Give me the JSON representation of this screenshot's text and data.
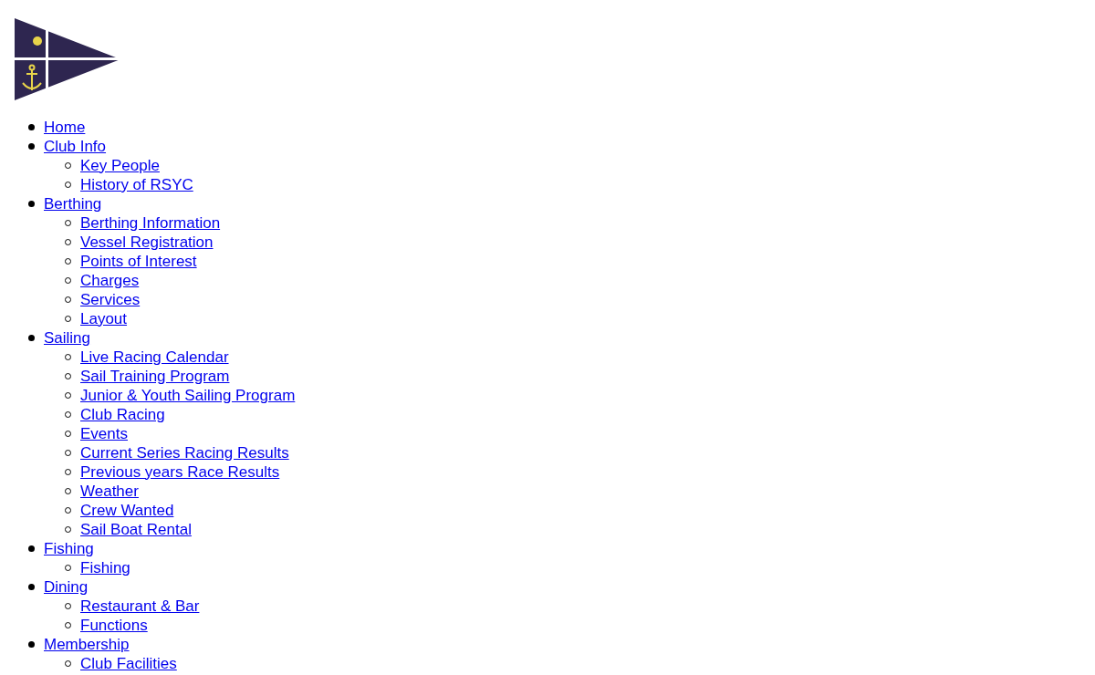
{
  "nav": [
    {
      "label": "Home"
    },
    {
      "label": "Club Info",
      "children": [
        {
          "label": "Key People"
        },
        {
          "label": "History of RSYC"
        }
      ]
    },
    {
      "label": "Berthing",
      "children": [
        {
          "label": "Berthing Information"
        },
        {
          "label": "Vessel Registration"
        },
        {
          "label": "Points of Interest"
        },
        {
          "label": "Charges"
        },
        {
          "label": "Services"
        },
        {
          "label": "Layout"
        }
      ]
    },
    {
      "label": "Sailing",
      "children": [
        {
          "label": "Live Racing Calendar"
        },
        {
          "label": "Sail Training Program"
        },
        {
          "label": "Junior & Youth Sailing Program"
        },
        {
          "label": "Club Racing"
        },
        {
          "label": "Events"
        },
        {
          "label": "Current Series Racing Results"
        },
        {
          "label": "Previous years Race Results"
        },
        {
          "label": "Weather"
        },
        {
          "label": "Crew Wanted"
        },
        {
          "label": "Sail Boat Rental"
        }
      ]
    },
    {
      "label": "Fishing",
      "children": [
        {
          "label": "Fishing"
        }
      ]
    },
    {
      "label": "Dining",
      "children": [
        {
          "label": "Restaurant & Bar"
        },
        {
          "label": "Functions"
        }
      ]
    },
    {
      "label": "Membership",
      "children": [
        {
          "label": "Club Facilities"
        }
      ]
    }
  ]
}
